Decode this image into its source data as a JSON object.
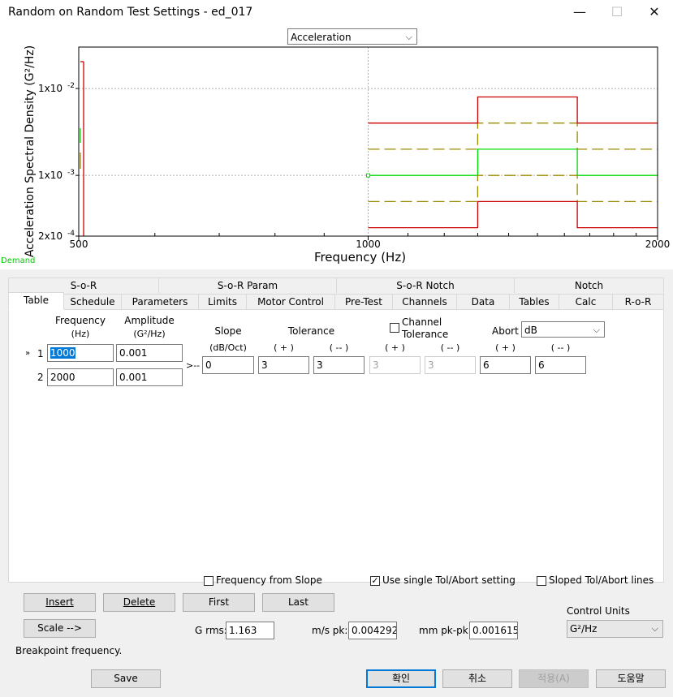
{
  "window": {
    "title": "Random on Random Test Settings - ed_017",
    "minimize_glyph": "—",
    "maximize_glyph": "☐",
    "close_glyph": "✕"
  },
  "chart_header": {
    "selector_value": "Acceleration"
  },
  "chart_data": {
    "type": "line",
    "x_scale": "log",
    "y_scale": "log",
    "xlim": [
      500,
      2000
    ],
    "ylim": [
      0.0002,
      0.03
    ],
    "xlabel": "Frequency (Hz)",
    "ylabel": "Acceleration Spectral Density (G²/Hz)",
    "x_ticks": [
      {
        "value": 500,
        "label": "500"
      },
      {
        "value": 1000,
        "label": "1000"
      },
      {
        "value": 2000,
        "label": "2000"
      }
    ],
    "y_ticks": [
      {
        "value": 0.0002,
        "base": "2x10",
        "exp": "-4"
      },
      {
        "value": 0.001,
        "base": "1x10",
        "exp": "-3"
      },
      {
        "value": 0.01,
        "base": "1x10",
        "exp": "-2"
      }
    ],
    "grid_x": [
      1000
    ],
    "grid_y": [
      0.001,
      0.01
    ],
    "demand_label": "Demand",
    "series": [
      {
        "color": "#00dd00",
        "style": "solid",
        "points": [
          [
            1000,
            0.001
          ],
          [
            1300,
            0.001
          ],
          [
            1300,
            0.002
          ],
          [
            1650,
            0.002
          ],
          [
            1650,
            0.001
          ],
          [
            2000,
            0.001
          ]
        ]
      },
      {
        "color": "#9a8a00",
        "style": "dashed",
        "points": [
          [
            1000,
            0.002
          ],
          [
            1300,
            0.002
          ],
          [
            1300,
            0.004
          ],
          [
            1650,
            0.004
          ],
          [
            1650,
            0.002
          ],
          [
            2000,
            0.002
          ]
        ]
      },
      {
        "color": "#9a8a00",
        "style": "dashed",
        "points": [
          [
            1000,
            0.0005
          ],
          [
            1300,
            0.0005
          ],
          [
            1300,
            0.001
          ],
          [
            1650,
            0.001
          ],
          [
            1650,
            0.0005
          ],
          [
            2000,
            0.0005
          ]
        ]
      },
      {
        "color": "#cc0000",
        "style": "solid",
        "points": [
          [
            1000,
            0.004
          ],
          [
            1300,
            0.004
          ],
          [
            1300,
            0.008
          ],
          [
            1650,
            0.008
          ],
          [
            1650,
            0.004
          ],
          [
            2000,
            0.004
          ]
        ]
      },
      {
        "color": "#cc0000",
        "style": "solid",
        "points": [
          [
            1000,
            0.00025
          ],
          [
            1300,
            0.00025
          ],
          [
            1300,
            0.0005
          ],
          [
            1650,
            0.0005
          ],
          [
            1650,
            0.00025
          ],
          [
            2000,
            0.00025
          ]
        ]
      }
    ]
  },
  "tabs_row1": [
    "S-o-R",
    "S-o-R Param",
    "S-o-R Notch",
    "Notch"
  ],
  "tabs_row2": [
    "Table",
    "Schedule",
    "Parameters",
    "Limits",
    "Motor Control",
    "Pre-Test",
    "Channels",
    "Data",
    "Tables",
    "Calc",
    "R-o-R"
  ],
  "table": {
    "freq_header": "Frequency",
    "freq_unit": "(Hz)",
    "amp_header": "Amplitude",
    "amp_unit": "(G²/Hz)",
    "slope_header": "Slope",
    "slope_unit": "(dB/Oct)",
    "tol_header": "Tolerance",
    "channel_tol_label": "Channel\nTolerance",
    "abort_label": "Abort",
    "abort_unit": "dB",
    "plus_label": "( + )",
    "minus_label": "( -- )",
    "row_marker": "»",
    "slope_arrow": ">--",
    "rows": [
      {
        "index": "1",
        "frequency": "1000",
        "amplitude": "0.001"
      },
      {
        "index": "2",
        "frequency": "2000",
        "amplitude": "0.001"
      }
    ],
    "slope_value": "0",
    "tol_plus": "3",
    "tol_minus": "3",
    "chan_plus": "3",
    "chan_minus": "3",
    "abort_plus": "6",
    "abort_minus": "6"
  },
  "options": {
    "freq_from_slope": "Frequency from Slope",
    "use_single": "Use single Tol/Abort setting",
    "sloped_lines": "Sloped Tol/Abort lines",
    "checkmark": "✓"
  },
  "buttons": {
    "insert": "Insert",
    "delete": "Delete",
    "first": "First",
    "last": "Last",
    "scale": "Scale -->",
    "save": "Save",
    "ok": "확인",
    "cancel": "취소",
    "apply": "적용(A)",
    "help": "도움말"
  },
  "stats": {
    "grms_label": "G rms:",
    "grms_value": "1.163",
    "ms_label": "m/s pk:",
    "ms_value": "0.004292",
    "mm_label": "mm pk-pk:",
    "mm_value": "0.001615"
  },
  "control_units": {
    "label": "Control Units",
    "value": "G²/Hz"
  },
  "status": "Breakpoint frequency."
}
